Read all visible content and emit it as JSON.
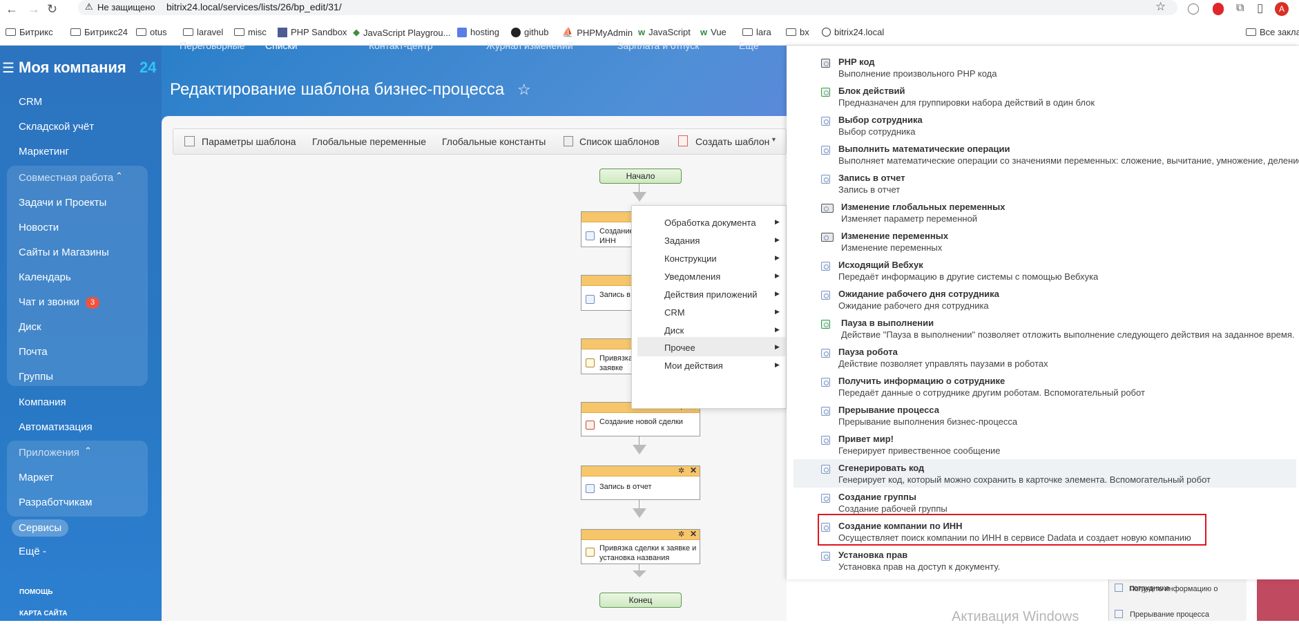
{
  "browser": {
    "security": "Не защищено",
    "url": "bitrix24.local/services/lists/26/bp_edit/31/",
    "bookmarks": [
      "Битрикс",
      "Битрикс24",
      "otus",
      "laravel",
      "misc",
      "PHP Sandbox",
      "JavaScript Playgrou...",
      "hosting",
      "github",
      "PHPMyAdmin",
      "JavaScript",
      "Vue",
      "lara",
      "bx",
      "bitrix24.local"
    ],
    "all_bookmarks": "Все заклад",
    "avatar": "A"
  },
  "sidebar": {
    "logo": "Моя компания",
    "logo_suffix": "24",
    "items": [
      "CRM",
      "Складской учёт",
      "Маркетинг"
    ],
    "group1_title": "Совместная работа",
    "group1_items": [
      "Задачи и Проекты",
      "Новости",
      "Сайты и Магазины",
      "Календарь",
      "Чат и звонки",
      "Диск",
      "Почта",
      "Группы"
    ],
    "chat_badge": "3",
    "items2": [
      "Компания",
      "Автоматизация"
    ],
    "group2_title": "Приложения",
    "group2_items": [
      "Маркет",
      "Разработчикам"
    ],
    "services": "Сервисы",
    "more": "Ещё",
    "help": "ПОМОЩЬ",
    "sitemap": "КАРТА САЙТА"
  },
  "page": {
    "title": "Редактирование шаблона бизнес-процесса",
    "top_tabs": [
      "Переговорные",
      "Списки",
      "Контакт-центр",
      "Журнал изменений",
      "Зарплата и отпуск",
      "Ещё"
    ]
  },
  "toolbar": {
    "params": "Параметры шаблона",
    "global_vars": "Глобальные переменные",
    "global_consts": "Глобальные константы",
    "templates_list": "Список шаблонов",
    "create_template": "Создать шаблон"
  },
  "flow": {
    "start": "Начало",
    "end": "Конец",
    "blocks": [
      "Создание ... ИНН",
      "Запись в ...",
      "Привязка ... заявке",
      "Создание новой сделки",
      "Запись в отчет",
      "Привязка сделки к заявке и установка названия"
    ],
    "b1a": "Создание",
    "b1b": "ИНН",
    "b2": "Запись в",
    "b3a": "Привязка",
    "b3b": "заявке",
    "b4": "Создание новой сделки",
    "b5": "Запись в отчет",
    "b6a": "Привязка сделки к заявке и",
    "b6b": "установка названия"
  },
  "context_menu": {
    "items": [
      "Обработка документа",
      "Задания",
      "Конструкции",
      "Уведомления",
      "Действия приложений",
      "CRM",
      "Диск",
      "Прочее",
      "Мои действия"
    ],
    "selected": "Прочее"
  },
  "activities": [
    {
      "title": "PHP код",
      "desc": "Выполнение произвольного PHP кода"
    },
    {
      "title": "Блок действий",
      "desc": "Предназначен для группировки набора действий в один блок"
    },
    {
      "title": "Выбор сотрудника",
      "desc": "Выбор сотрудника"
    },
    {
      "title": "Выполнить математические операции",
      "desc": "Выполняет математические операции со значениями переменных: сложение, вычитание, умножение, деление"
    },
    {
      "title": "Запись в отчет",
      "desc": "Запись в отчет"
    },
    {
      "title": "Изменение глобальных переменных",
      "desc": "Изменяет параметр переменной"
    },
    {
      "title": "Изменение переменных",
      "desc": "Изменение переменных"
    },
    {
      "title": "Исходящий Вебхук",
      "desc": "Передаёт информацию в другие системы с помощью Вебхука"
    },
    {
      "title": "Ожидание рабочего дня сотрудника",
      "desc": "Ожидание рабочего дня сотрудника"
    },
    {
      "title": "Пауза в выполнении",
      "desc": "Действие \"Пауза в выполнении\" позволяет отложить выполнение следующего действия на заданное время."
    },
    {
      "title": "Пауза робота",
      "desc": "Действие позволяет управлять паузами в роботах"
    },
    {
      "title": "Получить информацию о сотруднике",
      "desc": "Передаёт данные о сотруднике другим роботам. Вспомогательный робот"
    },
    {
      "title": "Прерывание процесса",
      "desc": "Прерывание выполнения бизнес-процесса"
    },
    {
      "title": "Привет мир!",
      "desc": "Генерирует привественное сообщение"
    },
    {
      "title": "Сгенерировать код",
      "desc": "Генерирует код, который можно сохранить в карточке элемента. Вспомогательный робот"
    },
    {
      "title": "Создание группы",
      "desc": "Создание рабочей группы"
    },
    {
      "title": "Создание компании по ИНН",
      "desc": "Осуществляет поиск компании по ИНН в сервисе Dadata и создает новую компанию"
    },
    {
      "title": "Установка прав",
      "desc": "Установка прав на доступ к документу."
    }
  ],
  "behind_panel": {
    "item1": "Получить информацию о сотруднике",
    "item1a": "Получить информацию о",
    "item1b": "сотруднике",
    "item2": "Прерывание процесса"
  },
  "watermark": "Активация Windows",
  "colors": {
    "sidebar": "#2a74c0",
    "highlight_border": "#e0141e",
    "block_head": "#f7c56a",
    "terminal": "#cfe9c2"
  }
}
